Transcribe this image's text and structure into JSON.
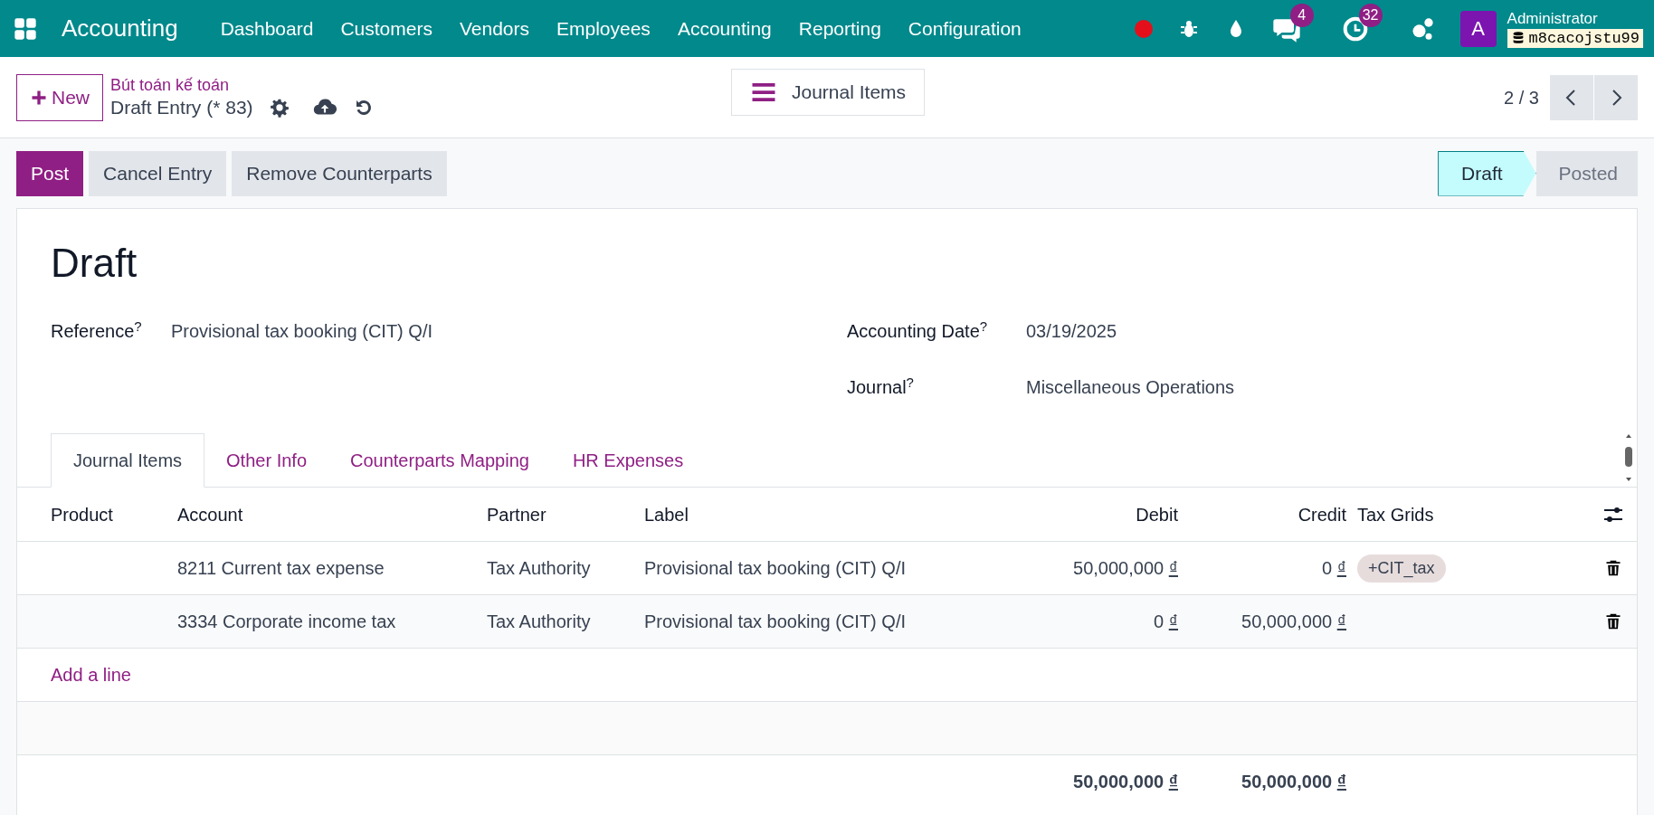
{
  "navbar": {
    "app_name": "Accounting",
    "menu": [
      "Dashboard",
      "Customers",
      "Vendors",
      "Employees",
      "Accounting",
      "Reporting",
      "Configuration"
    ],
    "messages_count": "4",
    "activities_count": "32",
    "avatar_letter": "A",
    "user_name": "Administrator",
    "database": "m8cacojstu99"
  },
  "control_panel": {
    "new_button": "New",
    "breadcrumb_parent": "Bút toán kế toán",
    "record_name": "Draft Entry (* 83)",
    "view_switch": "Journal Items",
    "pager": "2 / 3"
  },
  "actions": [
    {
      "label": "Post",
      "primary": true
    },
    {
      "label": "Cancel Entry",
      "primary": false
    },
    {
      "label": "Remove Counterparts",
      "primary": false
    }
  ],
  "statusbar": [
    {
      "label": "Draft",
      "selected": true
    },
    {
      "label": "Posted",
      "selected": false
    }
  ],
  "form": {
    "title": "Draft",
    "fields_left": [
      {
        "label": "Reference",
        "help": "?",
        "value": "Provisional tax booking (CIT) Q/I"
      }
    ],
    "fields_right": [
      {
        "label": "Accounting Date",
        "help": "?",
        "value": "03/19/2025"
      },
      {
        "label": "Journal",
        "help": "?",
        "value": "Miscellaneous Operations"
      }
    ]
  },
  "tabs": [
    {
      "label": "Journal Items",
      "selected": true
    },
    {
      "label": "Other Info",
      "selected": false
    },
    {
      "label": "Counterparts Mapping",
      "selected": false
    },
    {
      "label": "HR Expenses",
      "selected": false
    }
  ],
  "table": {
    "columns": [
      "Product",
      "Account",
      "Partner",
      "Label",
      "Debit",
      "Credit",
      "Tax Grids"
    ],
    "rows": [
      {
        "product": "",
        "account": "8211 Current tax expense",
        "partner": "Tax Authority",
        "label": "Provisional tax booking (CIT) Q/I",
        "debit": "50,000,000",
        "credit": "0",
        "currency": "₫",
        "tags": [
          "+CIT_tax"
        ]
      },
      {
        "account": "3334 Corporate income tax",
        "partner": "Tax Authority",
        "label": "Provisional tax booking (CIT) Q/I",
        "debit": "0",
        "credit": "50,000,000",
        "currency": "₫",
        "tags": []
      }
    ],
    "add_line": "Add a line",
    "total_debit": "50,000,000",
    "total_credit": "50,000,000",
    "total_currency": "₫"
  }
}
